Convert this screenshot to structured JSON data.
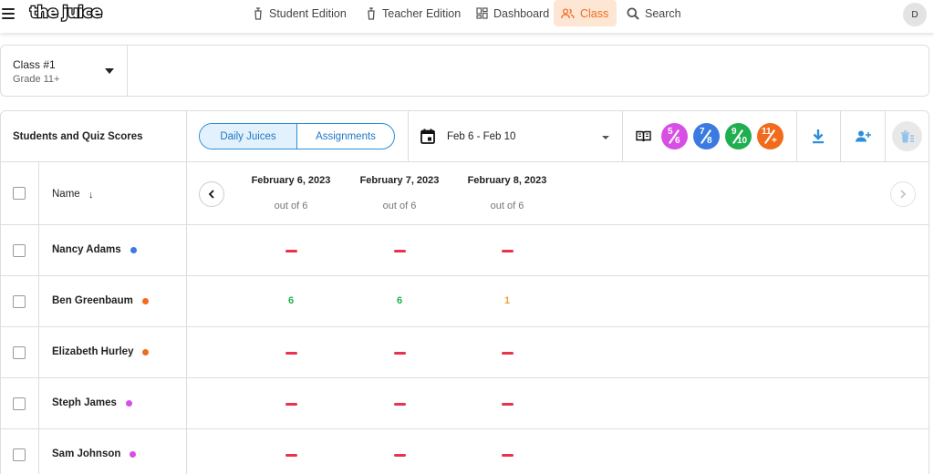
{
  "nav": {
    "logo": "the juice",
    "items": [
      {
        "id": "student",
        "label": "Student Edition"
      },
      {
        "id": "teacher",
        "label": "Teacher Edition"
      },
      {
        "id": "dashboard",
        "label": "Dashboard"
      },
      {
        "id": "class",
        "label": "Class",
        "active": true
      },
      {
        "id": "search",
        "label": "Search"
      }
    ],
    "avatar": "D",
    "accent": "#f26b1d"
  },
  "class_selector": {
    "name": "Class #1",
    "grade": "Grade 11+"
  },
  "toolbar": {
    "caption": "Students and Quiz Scores",
    "toggle": [
      "Daily Juices",
      "Assignments"
    ],
    "date_range": "Feb 6 - Feb 10",
    "levels": [
      {
        "top": "5",
        "bottom": "6",
        "color": "#d74fe4"
      },
      {
        "top": "7",
        "bottom": "8",
        "color": "#3b7ae0"
      },
      {
        "top": "9",
        "bottom": "10",
        "color": "#1fae50"
      },
      {
        "top": "11",
        "bottom": "+",
        "color": "#f26b1d"
      }
    ],
    "icons": [
      "book-icon",
      "download-icon",
      "add-user-icon",
      "delete-list-icon"
    ]
  },
  "table": {
    "name_header": "Name",
    "sort_indicator": "↓",
    "dates": [
      {
        "label": "February 6, 2023",
        "sub": "out of 6"
      },
      {
        "label": "February 7, 2023",
        "sub": "out of 6"
      },
      {
        "label": "February 8, 2023",
        "sub": "out of 6"
      }
    ],
    "students": [
      {
        "name": "Nancy Adams",
        "dot": "#3b7ae0",
        "scores": [
          "-",
          "-",
          "-"
        ]
      },
      {
        "name": "Ben Greenbaum",
        "dot": "#f26b1d",
        "scores": [
          "6",
          "6",
          "1"
        ]
      },
      {
        "name": "Elizabeth Hurley",
        "dot": "#f26b1d",
        "scores": [
          "-",
          "-",
          "-"
        ]
      },
      {
        "name": "Steph James",
        "dot": "#d74fe4",
        "scores": [
          "-",
          "-",
          "-"
        ]
      },
      {
        "name": "Sam Johnson",
        "dot": "#d74fe4",
        "scores": [
          "-",
          "-",
          "-"
        ]
      }
    ],
    "score_colors": {
      "high": "#1fae50",
      "low": "#e8a23b",
      "missing": "#e8334a"
    }
  }
}
